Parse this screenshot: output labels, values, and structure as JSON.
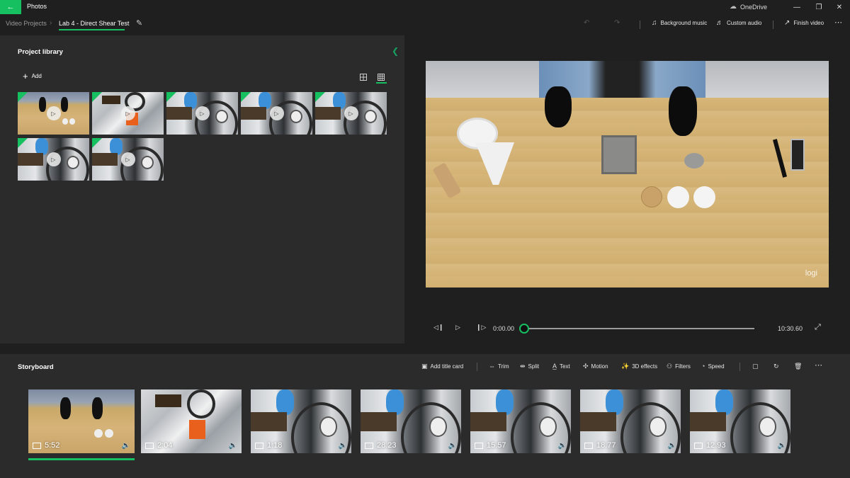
{
  "titlebar": {
    "app_title": "Photos",
    "back_icon": "arrow-left-icon",
    "onedrive_label": "OneDrive",
    "minimize_icon": "minimize-icon",
    "maximize_icon": "restore-icon",
    "close_icon": "close-icon"
  },
  "breadcrumb": {
    "root": "Video Projects",
    "separator": "›",
    "current": "Lab 4 - Direct Shear Test",
    "edit_icon": "pencil-icon"
  },
  "toolbar": {
    "undo_icon": "undo-icon",
    "redo_icon": "redo-icon",
    "background_music": "Background music",
    "custom_audio": "Custom audio",
    "finish_video": "Finish video",
    "more_icon": "more-icon"
  },
  "library": {
    "title": "Project library",
    "add_label": "Add",
    "view_small": "grid-large-icon",
    "view_large": "grid-small-icon",
    "items": [
      {
        "scene": "table",
        "in_use": true
      },
      {
        "scene": "machine",
        "in_use": true
      },
      {
        "scene": "gauge",
        "in_use": true
      },
      {
        "scene": "gauge",
        "in_use": true
      },
      {
        "scene": "gauge",
        "in_use": true
      },
      {
        "scene": "gauge",
        "in_use": true
      },
      {
        "scene": "gauge",
        "in_use": true
      }
    ]
  },
  "preview": {
    "watermark": "logi",
    "current_time": "0:00.00",
    "total_time": "10:30.60",
    "progress": 0.0
  },
  "storyboard": {
    "title": "Storyboard",
    "commands": {
      "add_title_card": "Add title card",
      "trim": "Trim",
      "split": "Split",
      "text": "Text",
      "motion": "Motion",
      "effects_3d": "3D effects",
      "filters": "Filters",
      "speed": "Speed"
    },
    "clips": [
      {
        "duration": "5:52",
        "scene": "table",
        "selected": true
      },
      {
        "duration": "2:04",
        "scene": "machine",
        "selected": false
      },
      {
        "duration": "1:18",
        "scene": "gauge",
        "selected": false
      },
      {
        "duration": "28.23",
        "scene": "gauge",
        "selected": false
      },
      {
        "duration": "15.57",
        "scene": "gauge",
        "selected": false
      },
      {
        "duration": "18.77",
        "scene": "gauge",
        "selected": false
      },
      {
        "duration": "12.93",
        "scene": "gauge",
        "selected": false
      }
    ]
  },
  "colors": {
    "accent": "#16c060",
    "panel": "#2b2b2b",
    "background": "#1f1f1f"
  }
}
